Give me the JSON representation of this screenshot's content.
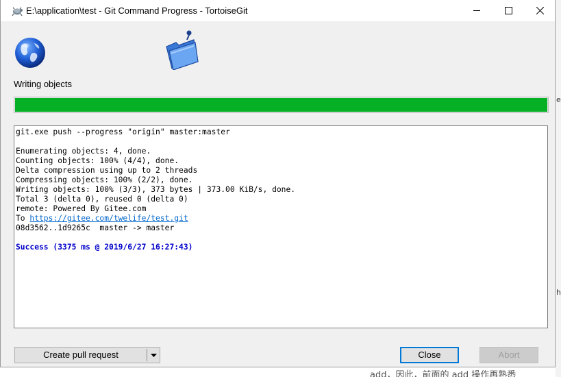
{
  "window": {
    "title": "E:\\application\\test - Git Command Progress - TortoiseGit"
  },
  "status": {
    "label": "Writing objects",
    "progress_fraction": 1.0,
    "progress_color": "#06b025"
  },
  "log": {
    "lines": [
      "git.exe push --progress \"origin\" master:master",
      "",
      "Enumerating objects: 4, done.",
      "Counting objects: 100% (4/4), done.",
      "Delta compression using up to 2 threads",
      "Compressing objects: 100% (2/2), done.",
      "Writing objects: 100% (3/3), 373 bytes | 373.00 KiB/s, done.",
      "Total 3 (delta 0), reused 0 (delta 0)",
      "remote: Powered By Gitee.com"
    ],
    "to_prefix": "To ",
    "url": "https://gitee.com/twelife/test.git",
    "ref_update": "08d3562..1d9265c  master -> master",
    "success": "Success (3375 ms @ 2019/6/27 16:27:43)",
    "success_color": "#0000cc"
  },
  "buttons": {
    "pull_request": "Create pull request",
    "close": "Close",
    "abort": "Abort"
  },
  "icons": {
    "app": "tortoisegit-icon",
    "globe": "globe-icon",
    "folder": "folder-icon",
    "dropdown": "chevron-down-icon"
  },
  "background": {
    "fragments": [
      "e",
      "h"
    ],
    "bottom_text": "add，因此，前面的 add 操作再熟悉"
  }
}
